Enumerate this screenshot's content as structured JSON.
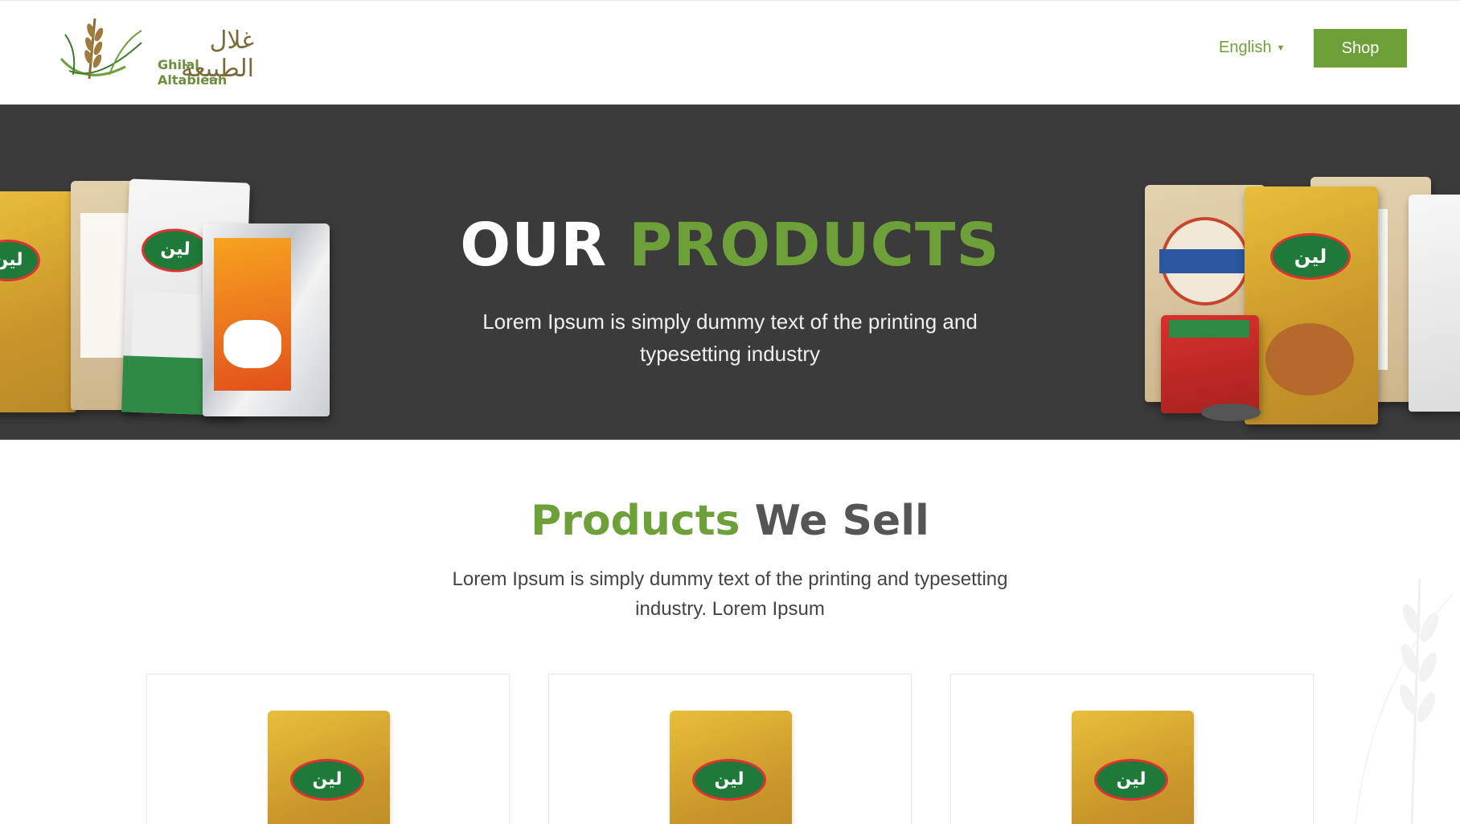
{
  "header": {
    "logo_arabic": "غلال الطبيعة",
    "logo_english": "Ghilal Altabieah",
    "language": "English",
    "shop_label": "Shop"
  },
  "hero": {
    "title_white": "OUR",
    "title_green": "PRODUCTS",
    "subtitle": "Lorem Ipsum is simply dummy text of the printing and typesetting industry"
  },
  "products": {
    "title_green": "Products",
    "title_dark": "We Sell",
    "subtitle": "Lorem Ipsum is simply dummy text of the printing and typesetting industry. Lorem Ipsum",
    "cards": [
      {
        "brand": "لين"
      },
      {
        "brand": "لين"
      },
      {
        "brand": "لين"
      }
    ]
  },
  "colors": {
    "accent_green": "#6ea03a",
    "hero_bg": "#3b3b3b",
    "heading_dark": "#555555"
  },
  "icons": {
    "logo": "wheat-icon",
    "language_caret": "chevron-down-icon"
  }
}
